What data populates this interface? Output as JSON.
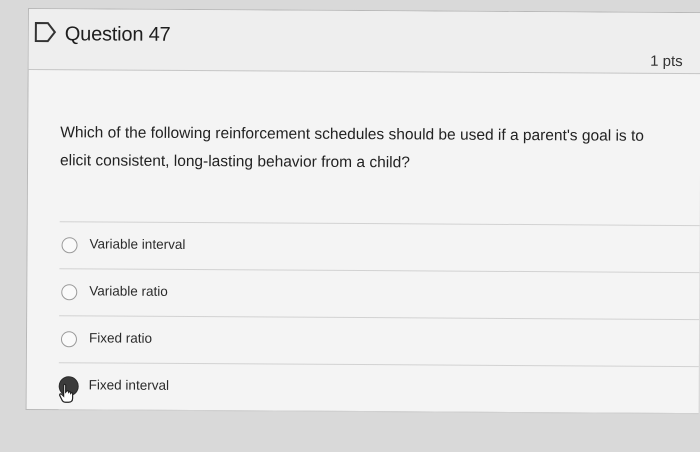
{
  "question": {
    "title": "Question 47",
    "points": "1 pts",
    "text": "Which of the following reinforcement schedules should be used if a parent's goal is to elicit consistent, long-lasting behavior from a child?"
  },
  "answers": [
    {
      "label": "Variable interval",
      "selected": false
    },
    {
      "label": "Variable ratio",
      "selected": false
    },
    {
      "label": "Fixed ratio",
      "selected": false
    },
    {
      "label": "Fixed interval",
      "selected": true
    }
  ],
  "colors": {
    "background": "#d9d9d9",
    "card": "#f4f4f4",
    "selected_radio": "#3b3b3b"
  },
  "icons": {
    "flag": "flag-icon",
    "cursor": "hand-pointer-icon"
  }
}
